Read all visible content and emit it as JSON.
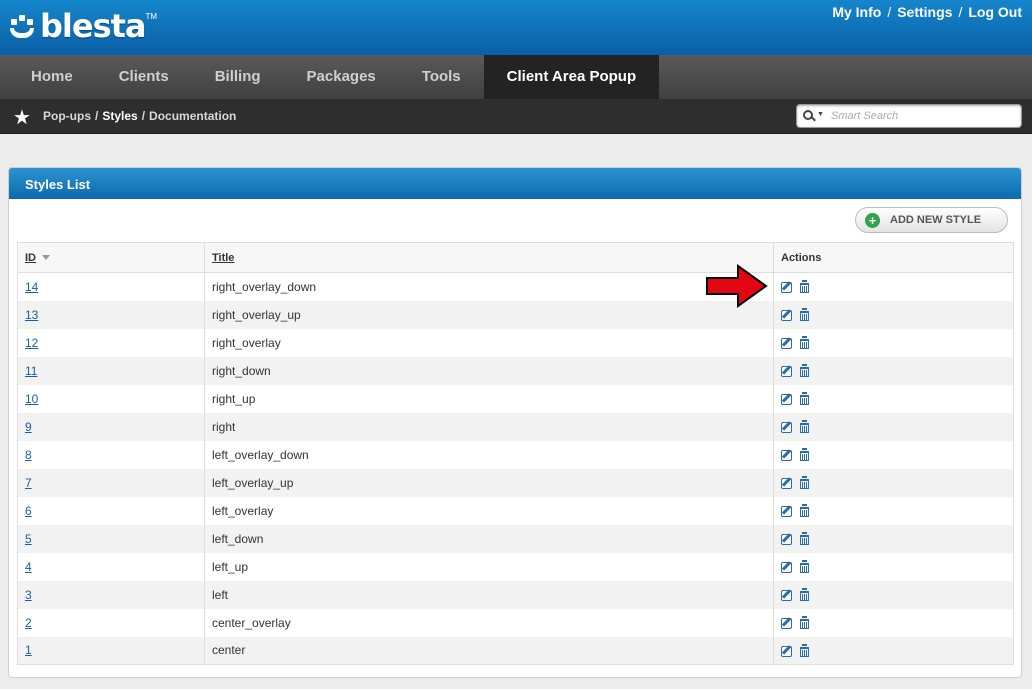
{
  "header": {
    "logo_text": "blesta",
    "logo_tm": "TM",
    "links": [
      "My Info",
      "Settings",
      "Log Out"
    ]
  },
  "nav": {
    "items": [
      "Home",
      "Clients",
      "Billing",
      "Packages",
      "Tools",
      "Client Area Popup"
    ],
    "active": "Client Area Popup"
  },
  "breadcrumb": {
    "items": [
      "Pop-ups",
      "Styles",
      "Documentation"
    ],
    "current": "Styles"
  },
  "search": {
    "placeholder": "Smart Search"
  },
  "panel": {
    "title": "Styles List",
    "add_button": "ADD NEW STYLE",
    "columns": {
      "id": "ID",
      "title": "Title",
      "actions": "Actions"
    },
    "rows": [
      {
        "id": "14",
        "title": "right_overlay_down"
      },
      {
        "id": "13",
        "title": "right_overlay_up"
      },
      {
        "id": "12",
        "title": "right_overlay"
      },
      {
        "id": "11",
        "title": "right_down"
      },
      {
        "id": "10",
        "title": "right_up"
      },
      {
        "id": "9",
        "title": "right"
      },
      {
        "id": "8",
        "title": "left_overlay_down"
      },
      {
        "id": "7",
        "title": "left_overlay_up"
      },
      {
        "id": "6",
        "title": "left_overlay"
      },
      {
        "id": "5",
        "title": "left_down"
      },
      {
        "id": "4",
        "title": "left_up"
      },
      {
        "id": "3",
        "title": "left"
      },
      {
        "id": "2",
        "title": "center_overlay"
      },
      {
        "id": "1",
        "title": "center"
      }
    ]
  },
  "colors": {
    "header_blue": "#0a5fa5",
    "arrow_red": "#e30613",
    "link_blue": "#1a5f9e",
    "add_green": "#2ea44a"
  }
}
